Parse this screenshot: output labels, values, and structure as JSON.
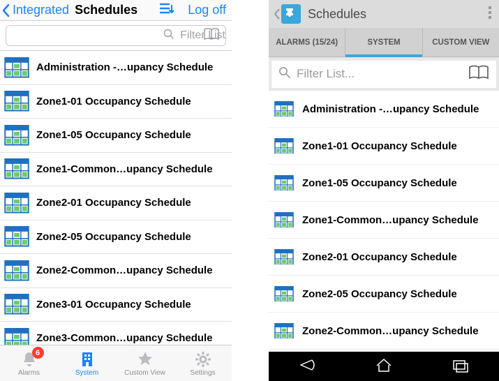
{
  "ios": {
    "back_label": "Integrated",
    "title": "Schedules",
    "logoff": "Log off",
    "filter_placeholder": "Filter List",
    "rows": [
      "Administration -…upancy Schedule",
      "Zone1-01 Occupancy Schedule",
      "Zone1-05 Occupancy Schedule",
      "Zone1-Common…upancy Schedule",
      "Zone2-01 Occupancy Schedule",
      "Zone2-05 Occupancy Schedule",
      "Zone2-Common…upancy Schedule",
      "Zone3-01 Occupancy Schedule",
      "Zone3-Common…upancy Schedule"
    ],
    "tabbar": {
      "alarms": "Alarms",
      "alarms_badge": "6",
      "system": "System",
      "custom": "Custom View",
      "settings": "Settings",
      "active": "system"
    }
  },
  "android": {
    "title": "Schedules",
    "tabs": {
      "alarms": "ALARMS (15/24)",
      "system": "SYSTEM",
      "custom": "CUSTOM VIEW",
      "active": "system"
    },
    "filter_placeholder": "Filter List...",
    "rows": [
      "Administration -…upancy Schedule",
      "Zone1-01 Occupancy Schedule",
      "Zone1-05 Occupancy Schedule",
      "Zone1-Common…upancy Schedule",
      "Zone2-01 Occupancy Schedule",
      "Zone2-05 Occupancy Schedule",
      "Zone2-Common…upancy Schedule"
    ]
  }
}
